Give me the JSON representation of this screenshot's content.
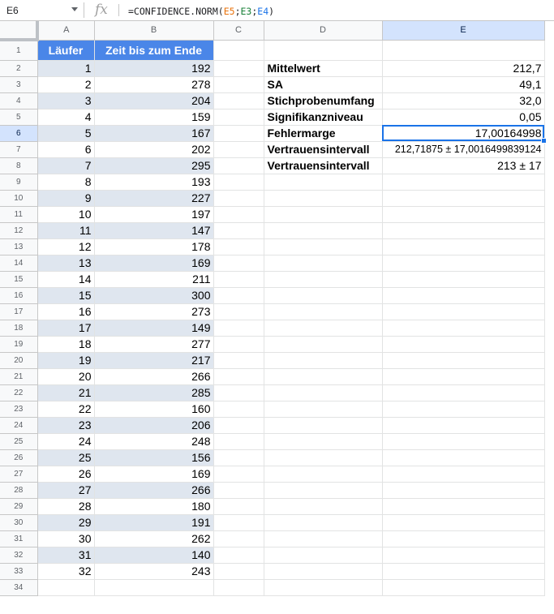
{
  "formula_bar": {
    "cell_ref": "E6",
    "fx_icon": "fx-icon",
    "formula_prefix": "=CONFIDENCE.NORM(",
    "formula_arg1": "E5",
    "formula_sep1": ";",
    "formula_arg2": "E3",
    "formula_sep2": ";",
    "formula_arg3": "E4",
    "formula_suffix": ")"
  },
  "colors": {
    "header_fill": "#4a86e8",
    "band_fill": "#dfe6ef",
    "selection": "#1a73e8",
    "ref_orange": "#e8710a",
    "ref_teal": "#188038",
    "ref_blue": "#1a73e8"
  },
  "columns": [
    "A",
    "B",
    "C",
    "D",
    "E"
  ],
  "selected_column": "E",
  "selected_row": 6,
  "row_numbers": [
    "1",
    "2",
    "3",
    "4",
    "5",
    "6",
    "7",
    "8",
    "9",
    "10",
    "11",
    "12",
    "13",
    "14",
    "15",
    "16",
    "17",
    "18",
    "19",
    "20",
    "21",
    "22",
    "23",
    "24",
    "25",
    "26",
    "27",
    "28",
    "29",
    "30",
    "31",
    "32",
    "33",
    "34"
  ],
  "table": {
    "header_a": "Läufer",
    "header_b": "Zeit bis zum Ende",
    "rows": [
      [
        "1",
        "192"
      ],
      [
        "2",
        "278"
      ],
      [
        "3",
        "204"
      ],
      [
        "4",
        "159"
      ],
      [
        "5",
        "167"
      ],
      [
        "6",
        "202"
      ],
      [
        "7",
        "295"
      ],
      [
        "8",
        "193"
      ],
      [
        "9",
        "227"
      ],
      [
        "10",
        "197"
      ],
      [
        "11",
        "147"
      ],
      [
        "12",
        "178"
      ],
      [
        "13",
        "169"
      ],
      [
        "14",
        "211"
      ],
      [
        "15",
        "300"
      ],
      [
        "16",
        "273"
      ],
      [
        "17",
        "149"
      ],
      [
        "18",
        "277"
      ],
      [
        "19",
        "217"
      ],
      [
        "20",
        "266"
      ],
      [
        "21",
        "285"
      ],
      [
        "22",
        "160"
      ],
      [
        "23",
        "206"
      ],
      [
        "24",
        "248"
      ],
      [
        "25",
        "156"
      ],
      [
        "26",
        "169"
      ],
      [
        "27",
        "266"
      ],
      [
        "28",
        "180"
      ],
      [
        "29",
        "191"
      ],
      [
        "30",
        "262"
      ],
      [
        "31",
        "140"
      ],
      [
        "32",
        "243"
      ]
    ]
  },
  "stats": [
    {
      "label": "Mittelwert",
      "value": "212,7"
    },
    {
      "label": "SA",
      "value": "49,1"
    },
    {
      "label": "Stichprobenumfang",
      "value": "32,0"
    },
    {
      "label": "Signifikanzniveau",
      "value": "0,05"
    },
    {
      "label": "Fehlermarge",
      "value": "17,00164998"
    },
    {
      "label": "Vertrauensintervall",
      "value": "212,71875 ± 17,0016499839124"
    },
    {
      "label": "Vertrauensintervall",
      "value": "213 ± 17"
    }
  ]
}
